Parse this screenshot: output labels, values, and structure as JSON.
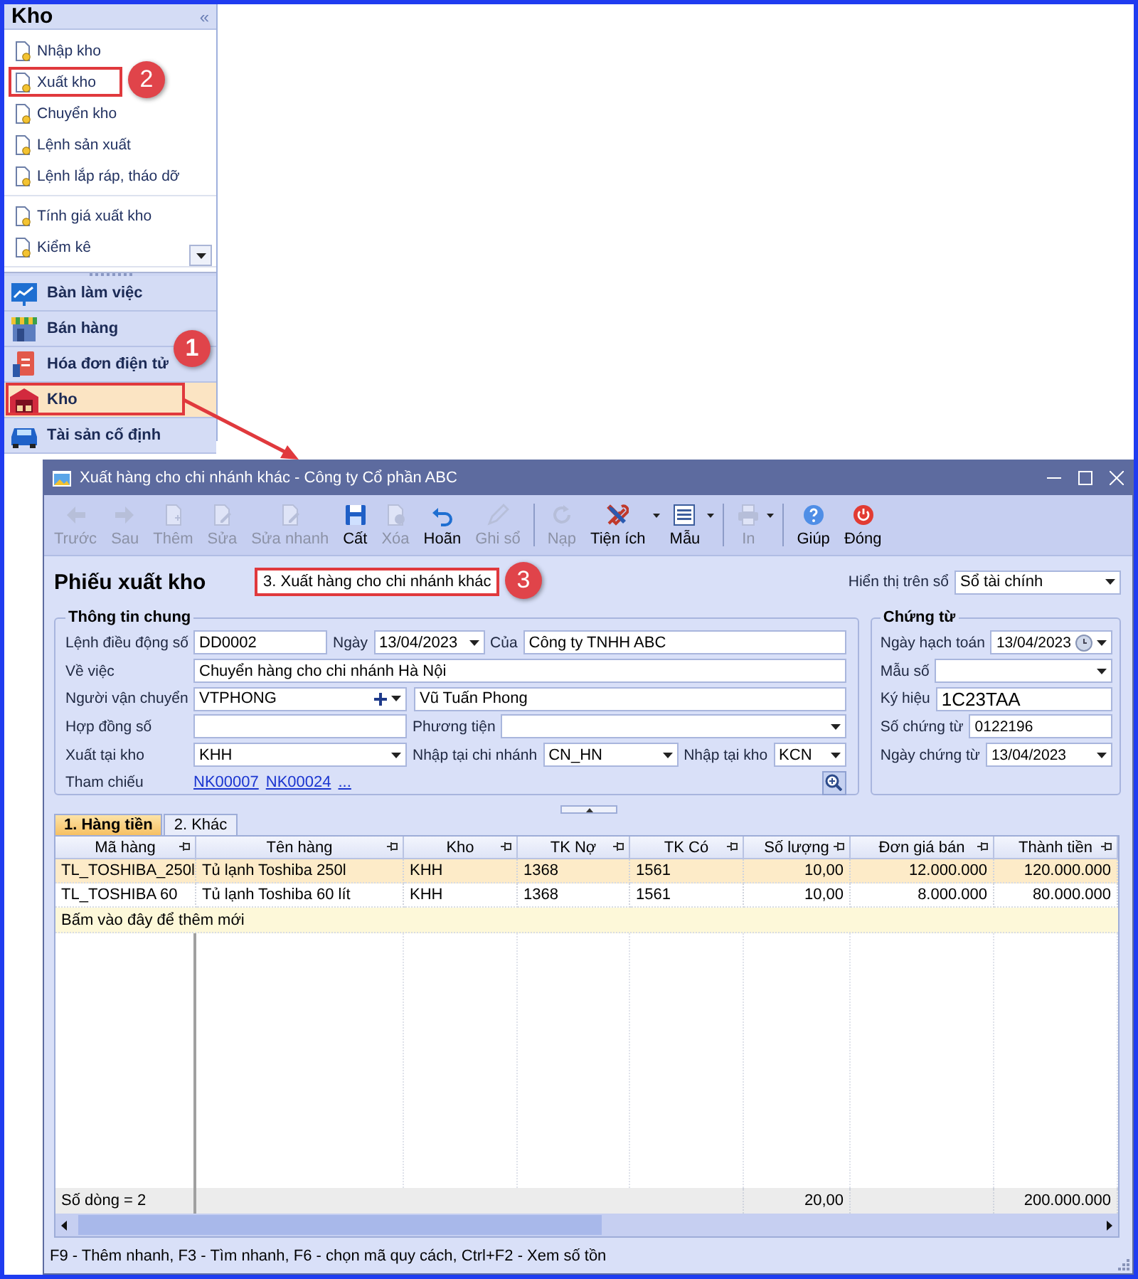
{
  "sidebar": {
    "title": "Kho",
    "collapse_icon": "«",
    "item_groups": [
      [
        {
          "label": "Nhập kho",
          "highlighted": false
        },
        {
          "label": "Xuất kho",
          "highlighted": true,
          "callout": "2"
        },
        {
          "label": "Chuyển kho",
          "highlighted": false
        },
        {
          "label": "Lệnh sản xuất",
          "highlighted": false
        },
        {
          "label": "Lệnh lắp ráp, tháo dỡ",
          "highlighted": false
        }
      ],
      [
        {
          "label": "Tính giá xuất kho",
          "highlighted": false
        },
        {
          "label": "Kiểm kê",
          "highlighted": false
        }
      ]
    ],
    "modules": [
      {
        "label": "Bàn làm việc",
        "kind": "desk",
        "selected": false,
        "highlighted": false
      },
      {
        "label": "Bán hàng",
        "kind": "shop",
        "selected": false,
        "highlighted": false
      },
      {
        "label": "Hóa đơn điện tử",
        "kind": "invoice",
        "selected": false,
        "highlighted": false
      },
      {
        "label": "Kho",
        "kind": "warehouse",
        "selected": true,
        "highlighted": true,
        "callout": "1"
      },
      {
        "label": "Tài sản cố định",
        "kind": "car",
        "selected": false,
        "highlighted": false
      }
    ]
  },
  "window": {
    "title": "Xuất hàng cho chi nhánh khác - Công ty Cổ phần ABC",
    "toolbar": [
      {
        "label": "Trước",
        "kind": "back",
        "enabled": false,
        "dropdown": false,
        "separator_before": false
      },
      {
        "label": "Sau",
        "kind": "forward",
        "enabled": false,
        "dropdown": false,
        "separator_before": false
      },
      {
        "label": "Thêm",
        "kind": "new",
        "enabled": false,
        "dropdown": false,
        "separator_before": false
      },
      {
        "label": "Sửa",
        "kind": "edit",
        "enabled": false,
        "dropdown": false,
        "separator_before": false
      },
      {
        "label": "Sửa nhanh",
        "kind": "edit",
        "enabled": false,
        "dropdown": false,
        "separator_before": false
      },
      {
        "label": "Cất",
        "kind": "save",
        "enabled": true,
        "dropdown": false,
        "separator_before": false
      },
      {
        "label": "Xóa",
        "kind": "delete",
        "enabled": false,
        "dropdown": false,
        "separator_before": false
      },
      {
        "label": "Hoãn",
        "kind": "undo",
        "enabled": true,
        "dropdown": false,
        "separator_before": false
      },
      {
        "label": "Ghi sổ",
        "kind": "pen",
        "enabled": false,
        "dropdown": false,
        "separator_before": false
      },
      {
        "label": "Nạp",
        "kind": "reload",
        "enabled": false,
        "dropdown": false,
        "separator_before": true
      },
      {
        "label": "Tiện ích",
        "kind": "tools",
        "enabled": true,
        "dropdown": true,
        "separator_before": false
      },
      {
        "label": "Mẫu",
        "kind": "template",
        "enabled": true,
        "dropdown": true,
        "separator_before": false
      },
      {
        "label": "In",
        "kind": "print",
        "enabled": false,
        "dropdown": true,
        "separator_before": true
      },
      {
        "label": "Giúp",
        "kind": "help",
        "enabled": true,
        "dropdown": false,
        "separator_before": true
      },
      {
        "label": "Đóng",
        "kind": "power",
        "enabled": true,
        "dropdown": false,
        "separator_before": false
      }
    ],
    "form": {
      "title": "Phiếu xuất kho",
      "type_select": {
        "value": "3. Xuất hàng cho chi nhánh khác",
        "highlighted": true,
        "callout": "3"
      },
      "ledger": {
        "label": "Hiển thị trên sổ",
        "value": "Sổ tài chính"
      },
      "general": {
        "title": "Thông tin chung",
        "rows": [
          [
            {
              "label": "Lệnh điều động số",
              "value": "DD0002",
              "kind": "text"
            },
            {
              "label": "Ngày",
              "value": "13/04/2023",
              "kind": "combo"
            },
            {
              "label": "Của",
              "value": "Công ty TNHH ABC",
              "kind": "text"
            }
          ],
          [
            {
              "label": "Về việc",
              "value": "Chuyển hàng cho chi nhánh Hà Nội",
              "kind": "text"
            }
          ],
          [
            {
              "label": "Người vận chuyển",
              "value": "VTPHONG",
              "kind": "lookup"
            },
            {
              "value": "Vũ Tuấn Phong",
              "kind": "text"
            }
          ],
          [
            {
              "label": "Hợp đồng số",
              "kind": "text"
            },
            {
              "label": "Phương tiện",
              "kind": "combo"
            }
          ],
          [
            {
              "label": "Xuất tại kho",
              "value": "KHH",
              "kind": "combo"
            },
            {
              "label": "Nhập tại chi nhánh",
              "value": "CN_HN",
              "kind": "combo"
            },
            {
              "label": "Nhập tại kho",
              "value": "KCN",
              "kind": "combo"
            }
          ]
        ],
        "reference": {
          "label": "Tham chiếu",
          "links": [
            "NK00007",
            "NK00024",
            "..."
          ]
        }
      },
      "voucher": {
        "title": "Chứng từ",
        "fields": [
          {
            "label": "Ngày hạch toán",
            "value": "13/04/2023",
            "kind": "date"
          },
          {
            "label": "Mẫu số",
            "kind": "combo"
          },
          {
            "label": "Ký hiệu",
            "value": "1C23TAA",
            "kind": "large"
          },
          {
            "label": "Số chứng từ",
            "value": "0122196",
            "kind": "text"
          },
          {
            "label": "Ngày chứng từ",
            "value": "13/04/2023",
            "kind": "combo"
          }
        ]
      }
    },
    "tabs": [
      {
        "label": "1. Hàng tiền",
        "selected": true
      },
      {
        "label": "2. Khác",
        "selected": false
      }
    ],
    "grid": {
      "columns": [
        {
          "label": "Mã hàng",
          "kind": "text"
        },
        {
          "label": "Tên hàng",
          "kind": "text"
        },
        {
          "label": "Kho",
          "kind": "text"
        },
        {
          "label": "TK Nợ",
          "kind": "text"
        },
        {
          "label": "TK Có",
          "kind": "text"
        },
        {
          "label": "Số lượng",
          "kind": "number"
        },
        {
          "label": "Đơn giá bán",
          "kind": "number"
        },
        {
          "label": "Thành tiền",
          "kind": "number"
        }
      ],
      "rows": [
        {
          "selected": true,
          "cells": [
            "TL_TOSHIBA_250l",
            "Tủ lạnh Toshiba 250l",
            "KHH",
            "1368",
            "1561",
            "10,00",
            "12.000.000",
            "120.000.000"
          ]
        },
        {
          "selected": false,
          "cells": [
            "TL_TOSHIBA 60",
            "Tủ lạnh Toshiba 60 lít",
            "KHH",
            "1368",
            "1561",
            "10,00",
            "8.000.000",
            "80.000.000"
          ]
        }
      ],
      "new_row_hint": "Bấm vào đây để thêm mới",
      "footer": {
        "label": "Số dòng = 2",
        "quantity_total": "20,00",
        "amount_total": "200.000.000"
      }
    },
    "status_bar": "F9 - Thêm nhanh, F3 - Tìm nhanh, F6 - chọn mã quy cách, Ctrl+F2 - Xem số tồn"
  }
}
